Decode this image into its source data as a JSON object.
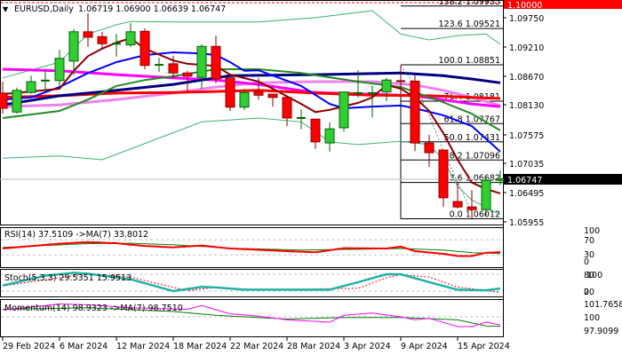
{
  "header": {
    "symbol": "EURUSD,Daily",
    "ohlc": "1.06719 1.06900 1.06639 1.06747"
  },
  "price_axis": {
    "labels": [
      "1.09750",
      "1.09210",
      "1.08670",
      "1.08130",
      "1.07575",
      "1.07035",
      "1.06495",
      "1.05955"
    ],
    "top_box": "1.10000",
    "current_price": "1.06747",
    "top_box_color": "#ff0000",
    "current_box_color": "#000000"
  },
  "fib_levels": [
    {
      "label": "138.2 1.09935",
      "price": 1.09935
    },
    {
      "label": "123.6 1.09521",
      "price": 1.09521
    },
    {
      "label": "100.0 1.08851",
      "price": 1.08851
    },
    {
      "label": "76.4 1.08181",
      "price": 1.08181
    },
    {
      "label": "61.8 1.07767",
      "price": 1.07767
    },
    {
      "label": "50.0 1.07431",
      "price": 1.07431
    },
    {
      "label": "38.2 1.07096",
      "price": 1.07096
    },
    {
      "label": "23.6 1.06682",
      "price": 1.06682
    },
    {
      "label": "0.0 1.06012",
      "price": 1.06012
    }
  ],
  "indicators": {
    "rsi": {
      "label": "RSI(14) 37.5109  ->MA(7) 33.8012",
      "axis": [
        "100",
        "70",
        "30",
        "0"
      ]
    },
    "stoch": {
      "label": "Stoch(5,3,3) 29.5351 15.9513",
      "axis": [
        "80",
        "100",
        "20",
        "0"
      ]
    },
    "momentum": {
      "label": "Momentum(14) 98.9323  ->MA(7) 98.7510",
      "axis": [
        "101.7658",
        "100",
        "97.9099"
      ]
    }
  },
  "time_axis": [
    "29 Feb 2024",
    "6 Mar 2024",
    "12 Mar 2024",
    "18 Mar 2024",
    "22 Mar 2024",
    "28 Mar 2024",
    "3 Apr 2024",
    "9 Apr 2024",
    "15 Apr 2024"
  ],
  "colors": {
    "bull": "#32cd32",
    "bear": "#ff0000",
    "wick_bull": "#006400",
    "wick_bear": "#8b0000"
  },
  "chart_data": {
    "type": "candlestick",
    "title": "EURUSD,Daily",
    "ylim": [
      1.05955,
      1.1
    ],
    "candles": [
      [
        1.0833,
        1.0854,
        1.0795,
        1.0805
      ],
      [
        1.0798,
        1.0843,
        1.0795,
        1.0838
      ],
      [
        1.0834,
        1.0865,
        1.0832,
        1.0854
      ],
      [
        1.0856,
        1.0874,
        1.0838,
        1.0856
      ],
      [
        1.0856,
        1.0913,
        1.0846,
        1.0897
      ],
      [
        1.0892,
        1.0951,
        1.0866,
        1.0946
      ],
      [
        1.0946,
        1.098,
        1.0918,
        1.0936
      ],
      [
        1.0937,
        1.0946,
        1.0913,
        1.0924
      ],
      [
        1.0924,
        1.0942,
        1.09,
        1.0924
      ],
      [
        1.0922,
        1.0962,
        1.0918,
        1.0946
      ],
      [
        1.0947,
        1.0952,
        1.0877,
        1.0884
      ],
      [
        1.0885,
        1.0898,
        1.0872,
        1.0885
      ],
      [
        1.0887,
        1.0902,
        1.0861,
        1.087
      ],
      [
        1.087,
        1.0874,
        1.0834,
        1.0864
      ],
      [
        1.0862,
        1.0923,
        1.0841,
        1.0919
      ],
      [
        1.0919,
        1.0939,
        1.0851,
        1.0859
      ],
      [
        1.0861,
        1.0861,
        1.08,
        1.0807
      ],
      [
        1.0807,
        1.0841,
        1.0802,
        1.0834
      ],
      [
        1.0836,
        1.0861,
        1.0821,
        1.0829
      ],
      [
        1.0831,
        1.0831,
        1.0808,
        1.0825
      ],
      [
        1.0825,
        1.0825,
        1.0772,
        1.0787
      ],
      [
        1.0787,
        1.0803,
        1.0766,
        1.0787
      ],
      [
        1.0785,
        1.0785,
        1.073,
        1.0743
      ],
      [
        1.0741,
        1.0779,
        1.0725,
        1.0767
      ],
      [
        1.0769,
        1.0835,
        1.0762,
        1.0835
      ],
      [
        1.0833,
        1.0875,
        1.0825,
        1.0833
      ],
      [
        1.0833,
        1.0847,
        1.0788,
        1.0833
      ],
      [
        1.0835,
        1.0861,
        1.0818,
        1.0857
      ],
      [
        1.0855,
        1.0884,
        1.0835,
        1.0853
      ],
      [
        1.0855,
        1.0866,
        1.0726,
        1.0741
      ],
      [
        1.0741,
        1.0756,
        1.0697,
        1.0723
      ],
      [
        1.0728,
        1.0728,
        1.0623,
        1.064
      ],
      [
        1.0633,
        1.0667,
        1.062,
        1.0623
      ],
      [
        1.0623,
        1.0654,
        1.0602,
        1.0618
      ],
      [
        1.0618,
        1.0679,
        1.0607,
        1.0672
      ],
      [
        1.06719,
        1.069,
        1.06639,
        1.06747
      ]
    ],
    "overlays": [
      {
        "name": "bb-upper",
        "color": "#3cb371",
        "width": 1,
        "points": [
          [
            0,
            1.0861
          ],
          [
            4,
            1.089
          ],
          [
            6,
            1.0942
          ],
          [
            8,
            1.0959
          ],
          [
            9,
            1.0965
          ],
          [
            12,
            1.0964
          ],
          [
            18,
            1.0964
          ],
          [
            22,
            1.0972
          ],
          [
            26,
            1.0985
          ],
          [
            28,
            1.0942
          ],
          [
            30,
            1.0931
          ],
          [
            32,
            1.0939
          ],
          [
            34,
            1.0942
          ],
          [
            35,
            1.0923
          ]
        ]
      },
      {
        "name": "bb-lower",
        "color": "#3cb371",
        "width": 1,
        "points": [
          [
            0,
            1.0713
          ],
          [
            4,
            1.0717
          ],
          [
            7,
            1.071
          ],
          [
            14,
            1.078
          ],
          [
            18,
            1.0787
          ],
          [
            21,
            1.078
          ],
          [
            22,
            1.0762
          ],
          [
            23,
            1.0743
          ],
          [
            25,
            1.0738
          ],
          [
            28,
            1.0744
          ],
          [
            30,
            1.0738
          ],
          [
            31,
            1.071
          ],
          [
            32,
            1.0661
          ],
          [
            33,
            1.0636
          ],
          [
            35,
            1.0609
          ]
        ]
      },
      {
        "name": "ma-violet",
        "color": "#ee82ee",
        "width": 3,
        "points": [
          [
            0,
            1.0808
          ],
          [
            4,
            1.0811
          ],
          [
            8,
            1.0821
          ],
          [
            12,
            1.0833
          ],
          [
            15,
            1.0844
          ],
          [
            18,
            1.0852
          ],
          [
            22,
            1.0854
          ],
          [
            26,
            1.0854
          ],
          [
            29,
            1.0848
          ],
          [
            31,
            1.0838
          ],
          [
            33,
            1.0825
          ],
          [
            35,
            1.081
          ]
        ]
      },
      {
        "name": "ma-magenta",
        "color": "#ff00ff",
        "width": 3,
        "points": [
          [
            0,
            1.0877
          ],
          [
            4,
            1.0874
          ],
          [
            8,
            1.0867
          ],
          [
            12,
            1.0861
          ],
          [
            15,
            1.0857
          ],
          [
            18,
            1.0849
          ],
          [
            22,
            1.0834
          ],
          [
            26,
            1.0831
          ],
          [
            29,
            1.0828
          ],
          [
            33,
            1.0813
          ],
          [
            35,
            1.0808
          ]
        ]
      },
      {
        "name": "ma-red",
        "color": "#ff0000",
        "width": 3,
        "points": [
          [
            0,
            1.0825
          ],
          [
            4,
            1.0828
          ],
          [
            8,
            1.0833
          ],
          [
            12,
            1.0834
          ],
          [
            18,
            1.0838
          ],
          [
            22,
            1.0833
          ],
          [
            26,
            1.0829
          ],
          [
            30,
            1.0828
          ],
          [
            33,
            1.0825
          ],
          [
            35,
            1.0823
          ]
        ]
      },
      {
        "name": "ma-navy",
        "color": "#000080",
        "width": 3,
        "points": [
          [
            0,
            1.0811
          ],
          [
            4,
            1.0828
          ],
          [
            8,
            1.0838
          ],
          [
            12,
            1.0849
          ],
          [
            16,
            1.0865
          ],
          [
            22,
            1.0867
          ],
          [
            28,
            1.087
          ],
          [
            31,
            1.0865
          ],
          [
            33,
            1.0859
          ],
          [
            35,
            1.0852
          ]
        ]
      },
      {
        "name": "ma-green",
        "color": "#228b22",
        "width": 2,
        "points": [
          [
            0,
            1.0787
          ],
          [
            4,
            1.08
          ],
          [
            6,
            1.0821
          ],
          [
            8,
            1.0846
          ],
          [
            10,
            1.0857
          ],
          [
            12,
            1.0864
          ],
          [
            15,
            1.0877
          ],
          [
            18,
            1.0877
          ],
          [
            21,
            1.087
          ],
          [
            25,
            1.0854
          ],
          [
            28,
            1.0844
          ],
          [
            31,
            1.0816
          ],
          [
            33,
            1.0795
          ],
          [
            35,
            1.0764
          ]
        ]
      },
      {
        "name": "ma-blue",
        "color": "#0000ff",
        "width": 2,
        "points": [
          [
            0,
            1.0821
          ],
          [
            2,
            1.0825
          ],
          [
            4,
            1.0844
          ],
          [
            5,
            1.0857
          ],
          [
            6,
            1.087
          ],
          [
            8,
            1.089
          ],
          [
            10,
            1.0903
          ],
          [
            12,
            1.0908
          ],
          [
            14,
            1.0906
          ],
          [
            15,
            1.0903
          ],
          [
            16,
            1.089
          ],
          [
            17,
            1.0874
          ],
          [
            18,
            1.0875
          ],
          [
            21,
            1.0846
          ],
          [
            23,
            1.0813
          ],
          [
            24,
            1.0805
          ],
          [
            26,
            1.0808
          ],
          [
            28,
            1.081
          ],
          [
            29,
            1.0805
          ],
          [
            31,
            1.0792
          ],
          [
            33,
            1.0772
          ],
          [
            35,
            1.0725
          ]
        ]
      },
      {
        "name": "ma-brown",
        "color": "#8b0000",
        "width": 2,
        "points": [
          [
            0,
            1.0831
          ],
          [
            4,
            1.0841
          ],
          [
            5,
            1.0874
          ],
          [
            6,
            1.0901
          ],
          [
            7,
            1.0915
          ],
          [
            8,
            1.0926
          ],
          [
            9,
            1.0934
          ],
          [
            10,
            1.0915
          ],
          [
            12,
            1.0893
          ],
          [
            13,
            1.0887
          ],
          [
            15,
            1.0883
          ],
          [
            16,
            1.0867
          ],
          [
            18,
            1.0854
          ],
          [
            19,
            1.0841
          ],
          [
            21,
            1.0813
          ],
          [
            22,
            1.0798
          ],
          [
            23,
            1.0802
          ],
          [
            25,
            1.0815
          ],
          [
            26,
            1.0825
          ],
          [
            27,
            1.0848
          ],
          [
            28,
            1.0841
          ],
          [
            29,
            1.0825
          ],
          [
            30,
            1.08
          ],
          [
            31,
            1.0759
          ],
          [
            32,
            1.071
          ],
          [
            33,
            1.0668
          ],
          [
            34,
            1.0656
          ],
          [
            35,
            1.0648
          ]
        ]
      },
      {
        "name": "bb-middle-dotted",
        "color": "#708090",
        "width": 1,
        "dashed": true,
        "points": [
          [
            28,
            1.0883
          ],
          [
            29,
            1.0849
          ],
          [
            30,
            1.0792
          ],
          [
            31,
            1.0726
          ],
          [
            32,
            1.0669
          ],
          [
            33,
            1.0612
          ]
        ]
      }
    ],
    "rsi": {
      "levels": [
        70,
        30
      ],
      "main": [
        [
          0,
          47
        ],
        [
          4,
          60
        ],
        [
          6,
          64
        ],
        [
          8,
          61
        ],
        [
          10,
          54
        ],
        [
          12,
          50
        ],
        [
          14,
          55
        ],
        [
          16,
          47
        ],
        [
          20,
          40
        ],
        [
          22,
          37
        ],
        [
          24,
          48
        ],
        [
          27,
          47
        ],
        [
          28,
          52
        ],
        [
          29,
          40
        ],
        [
          31,
          33
        ],
        [
          32,
          27
        ],
        [
          33,
          27
        ],
        [
          34,
          36
        ],
        [
          35,
          37.5
        ]
      ],
      "ma": [
        [
          0,
          50
        ],
        [
          6,
          60
        ],
        [
          9,
          61
        ],
        [
          12,
          57
        ],
        [
          16,
          48
        ],
        [
          21,
          43
        ],
        [
          25,
          45
        ],
        [
          28,
          47
        ],
        [
          31,
          43
        ],
        [
          33,
          36
        ],
        [
          35,
          34
        ]
      ]
    },
    "stoch": {
      "levels": [
        80,
        20
      ],
      "main": [
        [
          0,
          40
        ],
        [
          3,
          75
        ],
        [
          5,
          85
        ],
        [
          6,
          82
        ],
        [
          9,
          62
        ],
        [
          12,
          20
        ],
        [
          14,
          35
        ],
        [
          15,
          33
        ],
        [
          17,
          25
        ],
        [
          23,
          25
        ],
        [
          25,
          52
        ],
        [
          27,
          80
        ],
        [
          28,
          80
        ],
        [
          30,
          52
        ],
        [
          32,
          25
        ],
        [
          34,
          23
        ],
        [
          35,
          29.5
        ]
      ],
      "signal": [
        [
          0,
          38
        ],
        [
          3,
          60
        ],
        [
          6,
          82
        ],
        [
          9,
          70
        ],
        [
          11,
          45
        ],
        [
          13,
          22
        ],
        [
          15,
          33
        ],
        [
          18,
          25
        ],
        [
          25,
          30
        ],
        [
          27,
          68
        ],
        [
          28,
          78
        ],
        [
          30,
          70
        ],
        [
          32,
          35
        ],
        [
          34,
          22
        ],
        [
          35,
          16
        ]
      ]
    },
    "momentum": {
      "level": 100,
      "main": [
        [
          0,
          100.9
        ],
        [
          4,
          101.7
        ],
        [
          6,
          101.6
        ],
        [
          9,
          101.2
        ],
        [
          13,
          101.0
        ],
        [
          14,
          101.5
        ],
        [
          16,
          100.4
        ],
        [
          18,
          100.1
        ],
        [
          20,
          99.6
        ],
        [
          23,
          99.3
        ],
        [
          24,
          100.2
        ],
        [
          26,
          100.5
        ],
        [
          28,
          100.0
        ],
        [
          29,
          99.6
        ],
        [
          30,
          99.8
        ],
        [
          32,
          98.7
        ],
        [
          33,
          98.7
        ],
        [
          34,
          99.3
        ],
        [
          35,
          98.93
        ]
      ],
      "ma": [
        [
          0,
          101.0
        ],
        [
          6,
          101.2
        ],
        [
          12,
          100.7
        ],
        [
          15,
          100.2
        ],
        [
          20,
          99.7
        ],
        [
          24,
          99.9
        ],
        [
          28,
          99.9
        ],
        [
          32,
          99.6
        ],
        [
          34,
          98.8
        ],
        [
          35,
          98.75
        ]
      ]
    }
  }
}
